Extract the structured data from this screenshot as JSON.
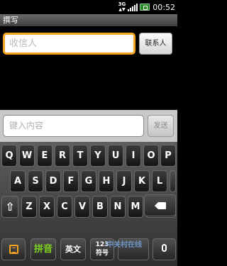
{
  "status_bar": {
    "network_type": "3G",
    "time": "00:52",
    "icons": [
      "network-3g-icon",
      "signal-icon",
      "battery-icon"
    ],
    "battery_color": "#2a8a2a"
  },
  "title_bar": {
    "title": "撰写"
  },
  "recipient": {
    "placeholder": "收信人",
    "contacts_button": "联系人",
    "focus_color": "#f5a321"
  },
  "compose": {
    "placeholder": "键入内容",
    "send_button": "发送"
  },
  "keyboard": {
    "row1": [
      "Q",
      "W",
      "E",
      "R",
      "T",
      "Y",
      "U",
      "I",
      "O",
      "P"
    ],
    "row2": [
      "A",
      "S",
      "D",
      "F",
      "G",
      "H",
      "J",
      "K",
      "L",
      "←"
    ],
    "row3": [
      "Z",
      "X",
      "C",
      "V",
      "B",
      "N",
      "M"
    ],
    "bottom": {
      "pinyin": "拼音",
      "english": "英文",
      "num_sym_top": "123",
      "num_sym_bottom": "符号"
    },
    "icons": [
      "calendar-icon",
      "shift-icon",
      "backspace-icon",
      "enter-icon",
      "space-key",
      "microphone-icon"
    ],
    "accent": "#f5a321",
    "pinyin_color": "#7ed321"
  },
  "watermark": "中关村在线"
}
